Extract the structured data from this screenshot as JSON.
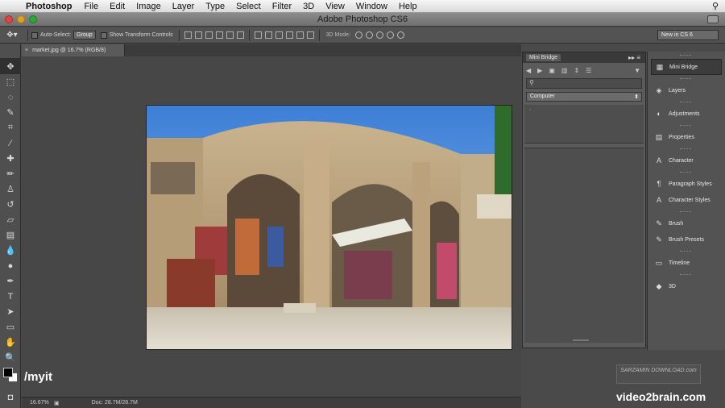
{
  "menubar": {
    "app_name": "Photoshop",
    "items": [
      "File",
      "Edit",
      "Image",
      "Layer",
      "Type",
      "Select",
      "Filter",
      "3D",
      "View",
      "Window",
      "Help"
    ]
  },
  "window": {
    "title": "Adobe Photoshop CS6"
  },
  "options_bar": {
    "auto_select_label": "Auto-Select:",
    "auto_select_value": "Group",
    "show_transform_label": "Show Transform Controls",
    "mode_3d_label": "3D Mode:",
    "workspace": "New in CS 6"
  },
  "document": {
    "tab_label": "market.jpg @ 16.7% (RGB/8)",
    "zoom": "16.67%",
    "doc_size": "Doc: 28.7M/28.7M"
  },
  "mini_bridge": {
    "title": "Mini Bridge",
    "location": "Computer"
  },
  "dock_panels": [
    {
      "label": "Mini Bridge",
      "icon": "mini-bridge-icon"
    },
    {
      "label": "Layers",
      "icon": "layers-icon"
    },
    {
      "label": "Adjustments",
      "icon": "adjustments-icon"
    },
    {
      "label": "Properties",
      "icon": "properties-icon"
    },
    {
      "label": "Character",
      "icon": "character-icon"
    },
    {
      "label": "Paragraph Styles",
      "icon": "paragraph-styles-icon"
    },
    {
      "label": "Character Styles",
      "icon": "character-styles-icon"
    },
    {
      "label": "Brush",
      "icon": "brush-icon"
    },
    {
      "label": "Brush Presets",
      "icon": "brush-presets-icon"
    },
    {
      "label": "Timeline",
      "icon": "timeline-icon"
    },
    {
      "label": "3D",
      "icon": "3d-icon"
    }
  ],
  "overlay": {
    "myit": "/myit",
    "brand": "video2brain.com",
    "watermark": "SARZAMIN DOWNLOAD.com"
  }
}
